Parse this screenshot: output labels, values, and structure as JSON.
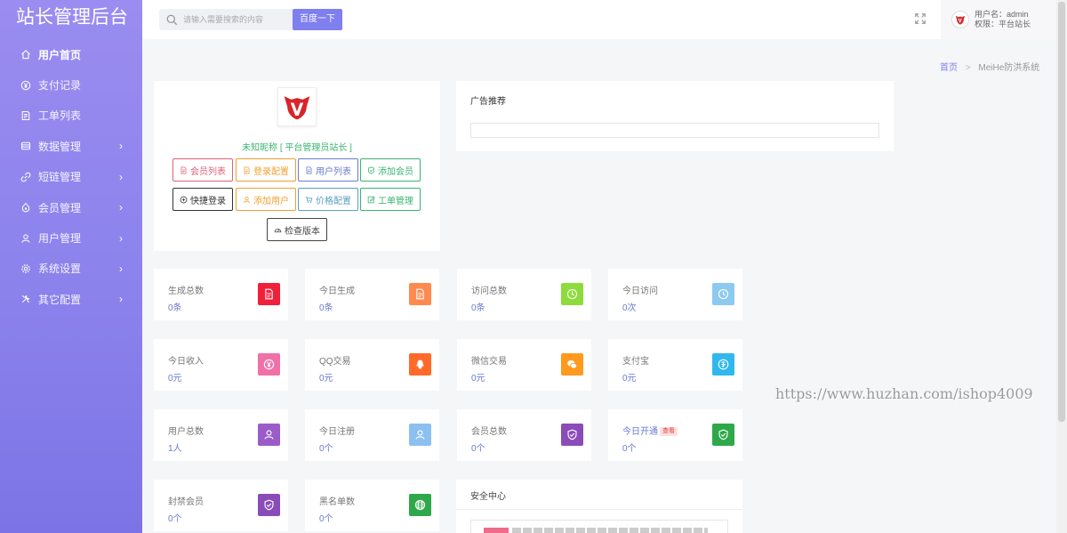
{
  "sidebar": {
    "title": "站长管理后台",
    "items": [
      {
        "label": "用户首页",
        "icon": "home-icon",
        "active": true,
        "has_arrow": false
      },
      {
        "label": "支付记录",
        "icon": "yen-circle-icon",
        "active": false,
        "has_arrow": false
      },
      {
        "label": "工单列表",
        "icon": "ticket-icon",
        "active": false,
        "has_arrow": false
      },
      {
        "label": "数据管理",
        "icon": "database-icon",
        "active": false,
        "has_arrow": true
      },
      {
        "label": "短链管理",
        "icon": "link-icon",
        "active": false,
        "has_arrow": true
      },
      {
        "label": "会员管理",
        "icon": "member-icon",
        "active": false,
        "has_arrow": true
      },
      {
        "label": "用户管理",
        "icon": "user-icon",
        "active": false,
        "has_arrow": true
      },
      {
        "label": "系统设置",
        "icon": "gear-icon",
        "active": false,
        "has_arrow": true
      },
      {
        "label": "其它配置",
        "icon": "tools-icon",
        "active": false,
        "has_arrow": true
      }
    ],
    "arrow_glyph": "›"
  },
  "header": {
    "search_placeholder": "请输入需要搜索的内容",
    "search_button": "百度一下",
    "user_name": "用户名：admin",
    "user_role": "权限：平台站长"
  },
  "breadcrumb": {
    "home": "首页",
    "separator": ">",
    "current": "MeiHe防洪系统"
  },
  "profile": {
    "nickname": "未知昵称 [ 平台管理员站长 ]",
    "buttons": [
      {
        "label": "会员列表",
        "icon": "doc-icon",
        "color": "#e0607a"
      },
      {
        "label": "登录配置",
        "icon": "doc-icon",
        "color": "#f0a030"
      },
      {
        "label": "用户列表",
        "icon": "doc-icon",
        "color": "#6a7bd0"
      },
      {
        "label": "添加会员",
        "icon": "shield-icon",
        "color": "#3cb371"
      },
      {
        "label": "快捷登录",
        "icon": "plus-circle-icon",
        "color": "#333333"
      },
      {
        "label": "添加用户",
        "icon": "user-icon",
        "color": "#f0a030"
      },
      {
        "label": "价格配置",
        "icon": "cart-icon",
        "color": "#5aa0c0"
      },
      {
        "label": "工单管理",
        "icon": "edit-icon",
        "color": "#3cb371"
      },
      {
        "label": "检查版本",
        "icon": "gauge-icon",
        "color": "#444444"
      }
    ]
  },
  "ad": {
    "title": "广告推荐"
  },
  "stats": [
    {
      "label": "生成总数",
      "value": "0条",
      "icon": "doc-icon",
      "color": "#f0203a"
    },
    {
      "label": "今日生成",
      "value": "0条",
      "icon": "doc-icon",
      "color": "#ff8a50"
    },
    {
      "label": "访问总数",
      "value": "0条",
      "icon": "clock-icon",
      "color": "#8cdc3c"
    },
    {
      "label": "今日访问",
      "value": "0次",
      "icon": "clock-icon",
      "color": "#8ccaf0"
    },
    {
      "label": "今日收入",
      "value": "0元",
      "icon": "yen-circle-icon",
      "color": "#f070a8"
    },
    {
      "label": "QQ交易",
      "value": "0元",
      "icon": "qq-icon",
      "color": "#ff6a2a"
    },
    {
      "label": "微信交易",
      "value": "0元",
      "icon": "wechat-icon",
      "color": "#ff9a1e"
    },
    {
      "label": "支付宝",
      "value": "0元",
      "icon": "alipay-icon",
      "color": "#30b8ec"
    },
    {
      "label": "用户总数",
      "value": "1人",
      "icon": "user-icon",
      "color": "#9a5cc8"
    },
    {
      "label": "今日注册",
      "value": "0个",
      "icon": "user-icon",
      "color": "#8cc0f0"
    },
    {
      "label": "会员总数",
      "value": "0个",
      "icon": "shield-icon",
      "color": "#8a4cb8"
    },
    {
      "label": "今日开通",
      "value": "0个",
      "icon": "shield-icon",
      "color": "#2ea84a",
      "tag": "查看"
    },
    {
      "label": "封禁会员",
      "value": "0个",
      "icon": "shield-icon",
      "color": "#8a4cb8"
    },
    {
      "label": "黑名单数",
      "value": "0个",
      "icon": "globe-icon",
      "color": "#2ea84a"
    }
  ],
  "security": {
    "title": "安全中心"
  },
  "watermark": "https://www.huzhan.com/ishop4009"
}
